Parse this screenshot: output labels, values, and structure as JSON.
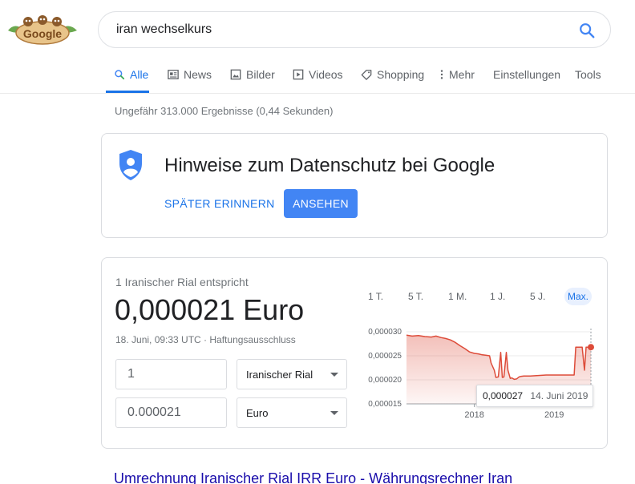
{
  "search": {
    "query": "iran wechselkurs"
  },
  "tabs": [
    {
      "label": "Alle",
      "icon": "search-icon",
      "active": true
    },
    {
      "label": "News",
      "icon": "news-icon"
    },
    {
      "label": "Bilder",
      "icon": "image-icon"
    },
    {
      "label": "Videos",
      "icon": "video-icon"
    },
    {
      "label": "Shopping",
      "icon": "tag-icon"
    },
    {
      "label": "Mehr",
      "icon": "more-vert-icon"
    },
    {
      "label": "Einstellungen"
    },
    {
      "label": "Tools"
    }
  ],
  "result_stats": "Ungefähr 313.000 Ergebnisse (0,44 Sekunden)",
  "privacy": {
    "title": "Hinweise zum Datenschutz bei Google",
    "remind_label": "SPÄTER ERINNERN",
    "view_label": "ANSEHEN"
  },
  "converter": {
    "equiv_label": "1 Iranischer Rial entspricht",
    "big_value": "0,000021 Euro",
    "date_line": "18. Juni, 09:33 UTC · Haftungsausschluss",
    "from_amount": "1",
    "from_currency": "Iranischer Rial",
    "to_amount": "0.000021",
    "to_currency": "Euro",
    "ranges": [
      "1 T.",
      "5 T.",
      "1 M.",
      "1 J.",
      "5 J.",
      "Max."
    ],
    "active_range": "Max."
  },
  "chart_data": {
    "type": "area",
    "y_ticks": [
      "0,000030",
      "0,000025",
      "0,000020",
      "0,000015"
    ],
    "x_ticks": [
      "2018",
      "2019"
    ],
    "ylim": [
      1.5e-05,
      3e-05
    ],
    "xlim": [
      2017.15,
      2019.47
    ],
    "series": [
      {
        "x": [
          2017.15,
          2017.22,
          2017.3,
          2017.38,
          2017.46,
          2017.52,
          2017.58,
          2017.64,
          2017.7,
          2017.76,
          2017.82,
          2017.88,
          2017.94,
          2018.0,
          2018.05,
          2018.1,
          2018.15,
          2018.19,
          2018.21,
          2018.25,
          2018.27,
          2018.3,
          2018.33,
          2018.35,
          2018.37,
          2018.4,
          2018.42,
          2018.45,
          2018.47,
          2018.5,
          2018.53,
          2018.56,
          2018.58,
          2018.62,
          2018.7,
          2018.8,
          2018.9,
          2019.0,
          2019.1,
          2019.2,
          2019.25,
          2019.27,
          2019.29,
          2019.31,
          2019.35,
          2019.38,
          2019.4,
          2019.42,
          2019.46
        ],
        "y": [
          2.93e-05,
          2.91e-05,
          2.92e-05,
          2.9e-05,
          2.89e-05,
          2.91e-05,
          2.88e-05,
          2.86e-05,
          2.83e-05,
          2.78e-05,
          2.71e-05,
          2.65e-05,
          2.58e-05,
          2.55e-05,
          2.54e-05,
          2.52e-05,
          2.51e-05,
          2.5e-05,
          2.35e-05,
          2.2e-05,
          2.05e-05,
          2.06e-05,
          2.57e-05,
          2.05e-05,
          2.06e-05,
          2.57e-05,
          2.2e-05,
          2.03e-05,
          2.04e-05,
          2.01e-05,
          2.02e-05,
          2.06e-05,
          2.07e-05,
          2.08e-05,
          2.08e-05,
          2.09e-05,
          2.1e-05,
          2.1e-05,
          2.1e-05,
          2.1e-05,
          2.1e-05,
          2.68e-05,
          2.68e-05,
          2.68e-05,
          2.68e-05,
          2.2e-05,
          2.68e-05,
          2.68e-05,
          2.68e-05
        ]
      }
    ],
    "tooltip": {
      "value": "0,000027",
      "date": "14. Juni 2019"
    },
    "line_color": "#dd4b39"
  },
  "result_link": "Umrechnung Iranischer Rial IRR Euro - Währungsrechner Iran"
}
